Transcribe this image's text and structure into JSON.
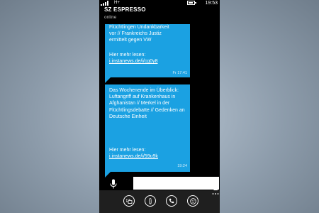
{
  "status_bar": {
    "network": "H+",
    "time": "19:53",
    "battery_level": 0.8
  },
  "chat": {
    "title": "SZ ESPRESSO",
    "status": "online"
  },
  "messages": [
    {
      "text": "Flüchtlingen Undankbarkeit\nvor // Frankreichs Justiz\nermittelt gegen VW",
      "more_label": "Hier mehr lesen:",
      "link": "i.instanews.de/i/cg0y8",
      "time": "Fr 17:41"
    },
    {
      "text": "Das Wochenende im Überblick: Luftangriff auf Krankenhaus in Afghanistan // Merkel in der Flüchtlingsdebatte // Gedenken an Deutsche Einheit",
      "more_label": "Hier mehr lesen:",
      "link": "i.instanews.de/i/59u9k",
      "time": "19:24"
    }
  ],
  "composer": {
    "placeholder": "",
    "mic_icon": "microphone-icon"
  },
  "app_bar": {
    "buttons": [
      "switch-icon",
      "attach-icon",
      "call-icon",
      "emoji-icon"
    ],
    "more_icon": "ellipsis-icon"
  }
}
